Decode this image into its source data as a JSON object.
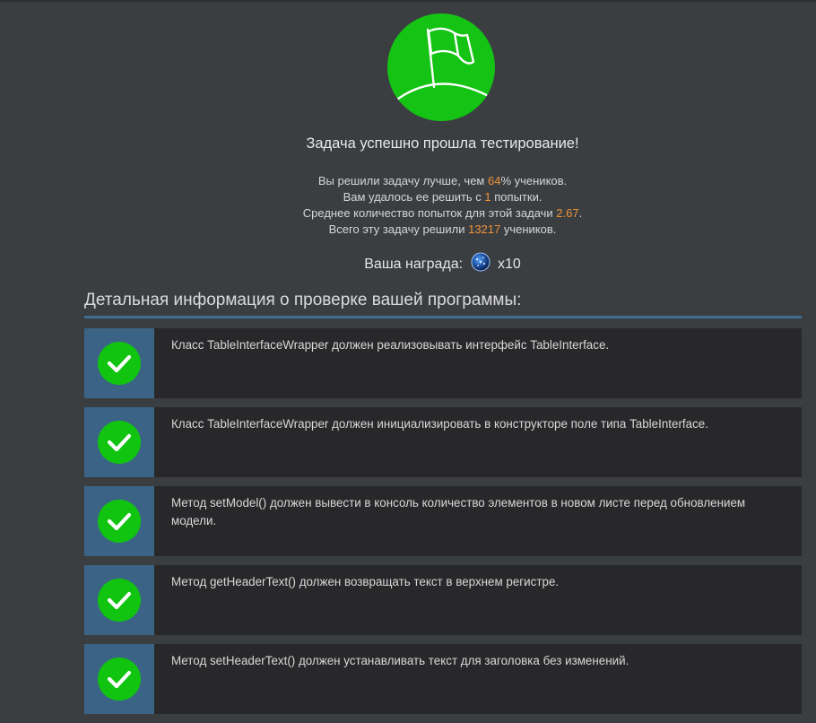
{
  "result": {
    "title": "Задача успешно прошла тестирование!",
    "colors": {
      "success_green": "#14c314",
      "highlight_orange": "#f0923a",
      "accent_blue": "#3a6385"
    }
  },
  "stats": {
    "line1": {
      "before": "Вы решили задачу лучше, чем ",
      "value": "64",
      "after": "% учеников."
    },
    "line2": {
      "before": "Вам удалось ее решить с ",
      "value": "1",
      "after": " попытки."
    },
    "line3": {
      "before": "Среднее количество попыток для этой задачи ",
      "value": "2.67",
      "after": "."
    },
    "line4": {
      "before": "Всего эту задачу решили ",
      "value": "13217",
      "after": " учеников."
    }
  },
  "reward": {
    "label": "Ваша награда:",
    "icon": "dark-matter-icon",
    "multiplier": "x10"
  },
  "details": {
    "title": "Детальная информация о проверке вашей программы:",
    "checks": [
      {
        "status": "passed",
        "text": "Класс TableInterfaceWrapper должен реализовывать интерфейс TableInterface."
      },
      {
        "status": "passed",
        "text": "Класс TableInterfaceWrapper должен инициализировать в конструкторе поле типа TableInterface."
      },
      {
        "status": "passed",
        "text": "Метод setModel() должен вывести в консоль количество элементов в новом листе перед обновлением модели."
      },
      {
        "status": "passed",
        "text": "Метод getHeaderText() должен возвращать текст в верхнем регистре."
      },
      {
        "status": "passed",
        "text": "Метод setHeaderText() должен устанавливать текст для заголовка без изменений."
      }
    ]
  }
}
